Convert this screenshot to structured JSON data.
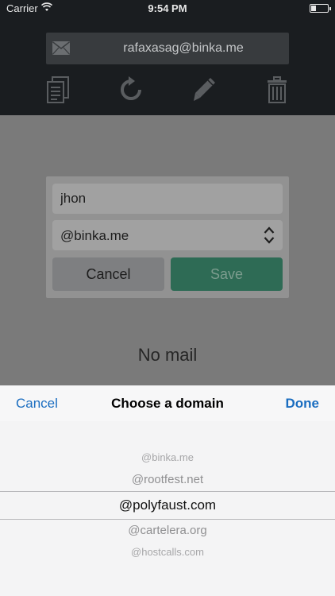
{
  "status_bar": {
    "carrier": "Carrier",
    "time": "9:54 PM",
    "icons": [
      "wifi-icon",
      "battery-icon"
    ]
  },
  "header": {
    "email": "rafaxasag@binka.me",
    "icons": [
      "mail-icon",
      "copy-icon",
      "refresh-icon",
      "edit-icon",
      "trash-icon"
    ]
  },
  "dialog": {
    "username_value": "jhon",
    "domain_value": "@binka.me",
    "cancel_label": "Cancel",
    "save_label": "Save"
  },
  "main": {
    "empty_text": "No mail"
  },
  "picker": {
    "cancel_label": "Cancel",
    "title": "Choose a domain",
    "done_label": "Done",
    "options": [
      "@binka.me",
      "@rootfest.net",
      "@polyfaust.com",
      "@cartelera.org",
      "@hostcalls.com"
    ],
    "selected": "@polyfaust.com"
  },
  "colors": {
    "header_bg": "#1a1d20",
    "overlay_bg": "#7a7a7a",
    "save_green": "#2e6b55",
    "link_blue": "#1a6dc0",
    "picker_bg": "#f4f4f5"
  }
}
